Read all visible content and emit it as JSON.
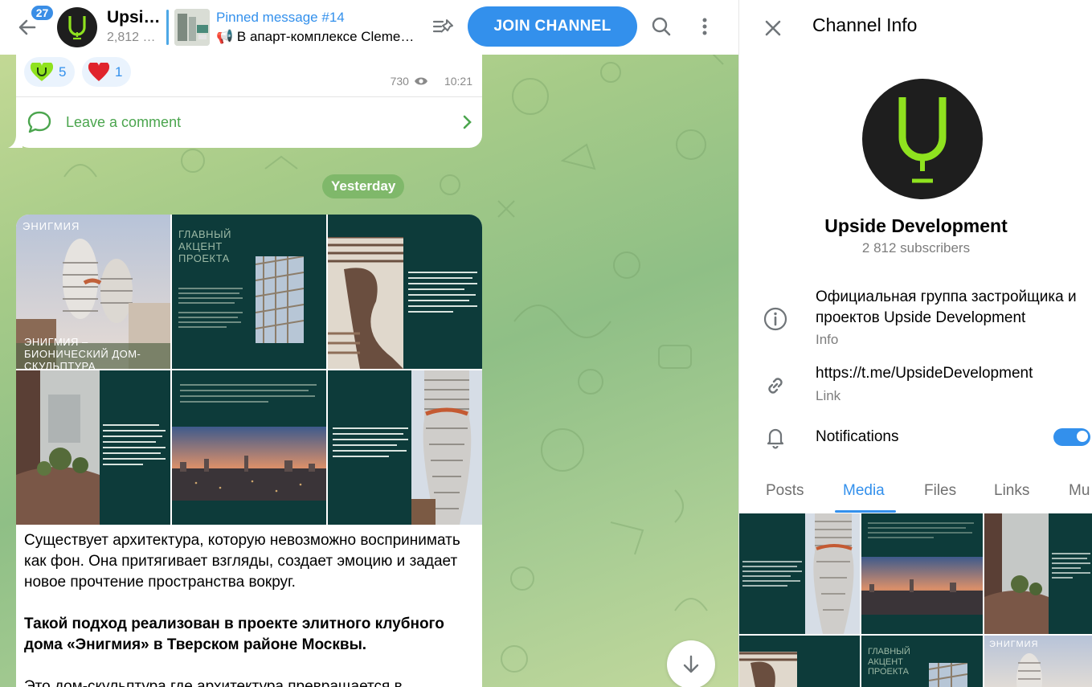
{
  "header": {
    "unread_count": "27",
    "channel_short": "Upsi…",
    "subscribers_short": "2,812 …",
    "pinned_title": "Pinned message #14",
    "pinned_text": "📢 В апарт-комплексе Cleme…",
    "join_label": "JOIN CHANNEL"
  },
  "message1": {
    "reactions": [
      {
        "emoji": "green-u-heart",
        "count": "5"
      },
      {
        "emoji": "red-heart",
        "count": "1"
      }
    ],
    "views": "730",
    "time": "10:21",
    "comment_label": "Leave a comment"
  },
  "date_separator": "Yesterday",
  "message2": {
    "tiles": {
      "t1_title": "ЭНИГМИЯ",
      "t1_caption": "ЭНИГМИЯ – БИОНИЧЕСКИЙ ДОМ-СКУЛЬПТУРА",
      "t2_title": "ГЛАВНЫЙ АКЦЕНТ ПРОЕКТА"
    },
    "paragraph1": "Существует архитектура, которую невозможно воспринимать как фон. Она притягивает взгляды, создает эмоцию и задает новое прочтение пространства вокруг.",
    "paragraph2": "Такой подход реализован в проекте элитного клубного дома «Энигмия» в Тверском районе Москвы.",
    "paragraph3": "Это дом-скульптура где архитектура превращается в"
  },
  "panel": {
    "title": "Channel Info",
    "channel_name": "Upside Development",
    "subscribers": "2 812 subscribers",
    "description": "Официальная группа застройщика и проектов Upside Development",
    "description_caption": "Info",
    "link": "https://t.me/UpsideDevelopment",
    "link_caption": "Link",
    "notifications_label": "Notifications",
    "notifications_on": true,
    "tabs": [
      "Posts",
      "Media",
      "Files",
      "Links",
      "Mu"
    ],
    "active_tab": "Media",
    "media_text": {
      "m5": "ГЛАВНЫЙ АКЦЕНТ ПРОЕКТА",
      "m6": "ЭНИГМИЯ"
    }
  },
  "colors": {
    "accent": "#3390ec",
    "brand_green": "#8fe21f",
    "comment_green": "#4ba54e",
    "dark_teal": "#0d3b3a"
  }
}
